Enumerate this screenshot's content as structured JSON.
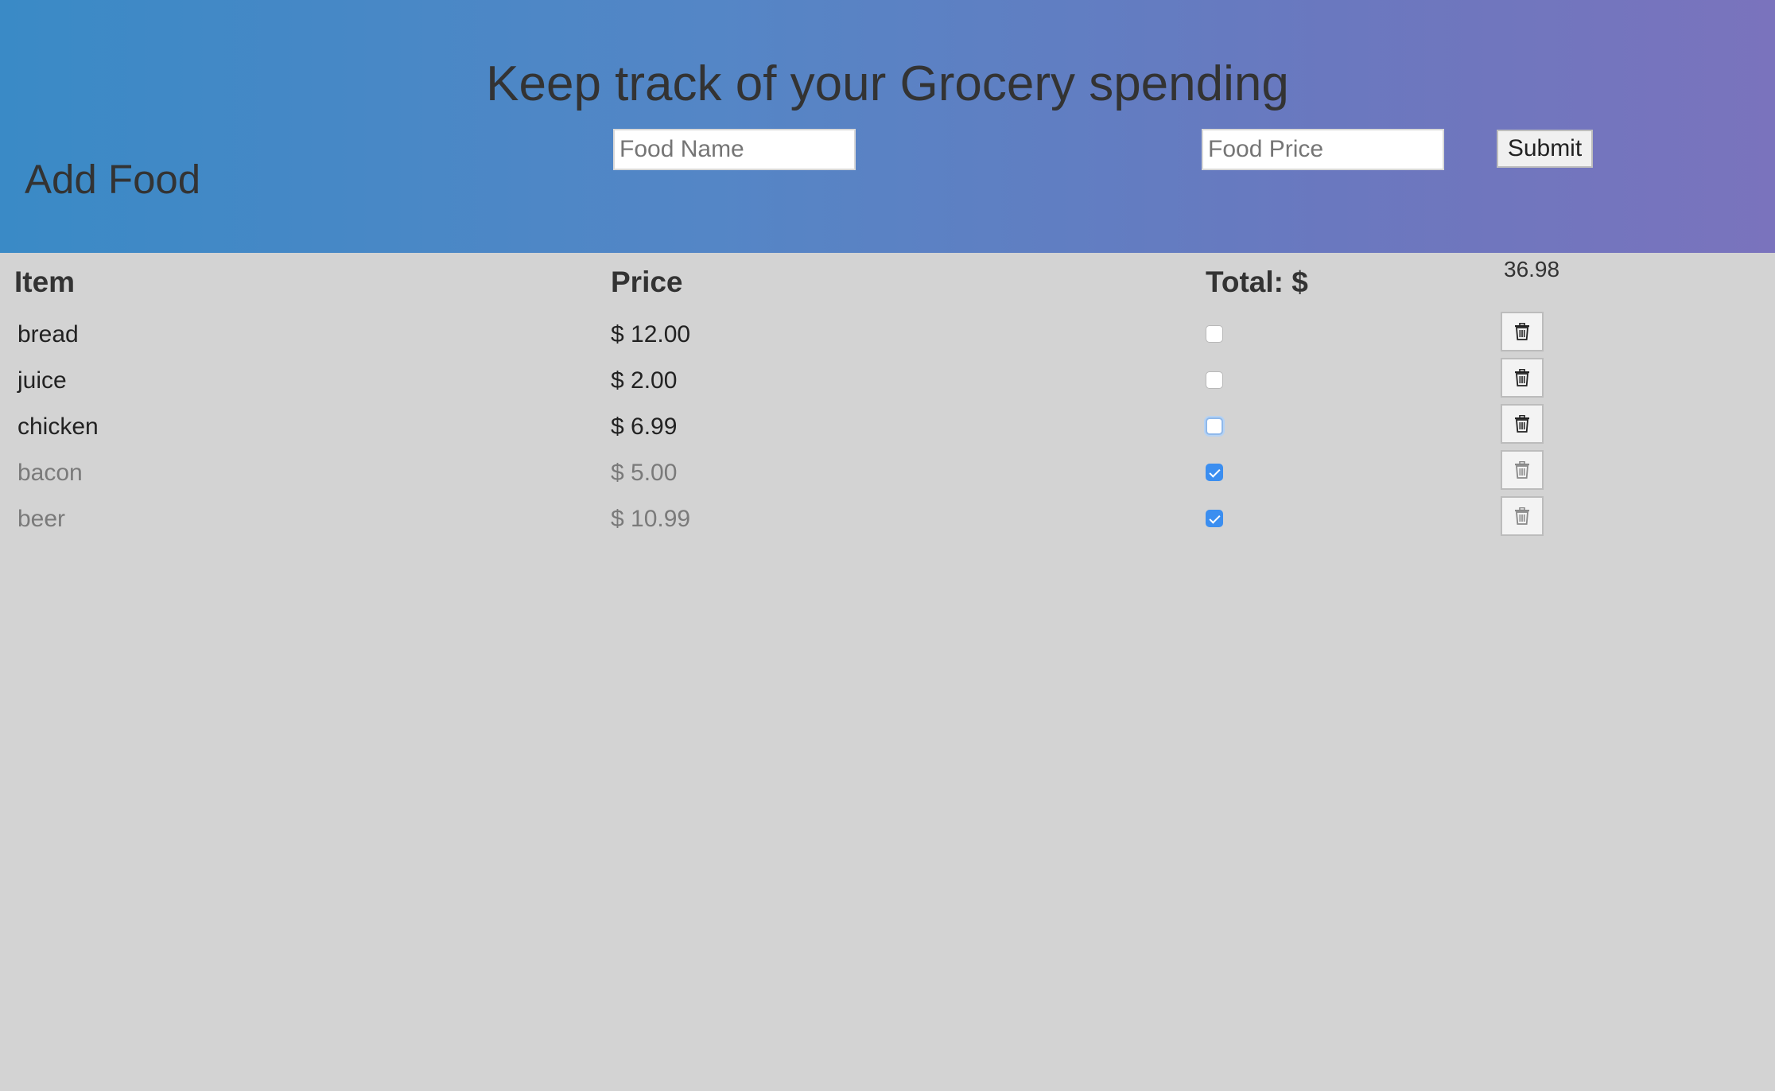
{
  "header": {
    "title": "Keep track of your Grocery spending",
    "add_food_label": "Add Food",
    "food_name_placeholder": "Food Name",
    "food_price_placeholder": "Food Price",
    "submit_label": "Submit"
  },
  "table": {
    "headers": {
      "item": "Item",
      "price": "Price",
      "total": "Total: $"
    },
    "total_value": "36.98",
    "rows": [
      {
        "name": "bread",
        "price": "$ 12.00",
        "checked": false
      },
      {
        "name": "juice",
        "price": "$ 2.00",
        "checked": false
      },
      {
        "name": "chicken",
        "price": "$ 6.99",
        "checked": false
      },
      {
        "name": "bacon",
        "price": "$ 5.00",
        "checked": true
      },
      {
        "name": "beer",
        "price": "$ 10.99",
        "checked": true
      }
    ]
  },
  "colors": {
    "header_gradient_start": "#3a8ac6",
    "header_gradient_end": "#7a73bd",
    "page_background": "#d3d3d3",
    "checkbox_checked": "#3b8ef0"
  },
  "icons": {
    "delete": "trash-icon"
  }
}
